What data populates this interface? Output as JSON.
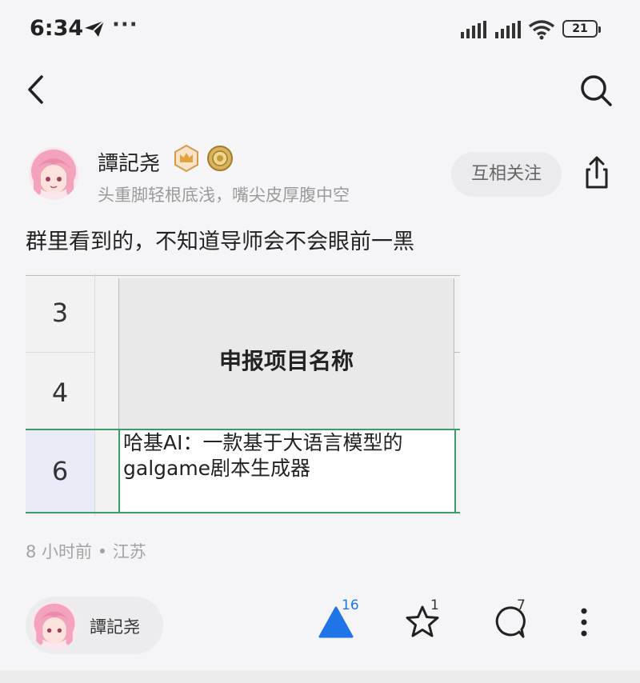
{
  "status_bar": {
    "time": "6:34",
    "more": "···",
    "battery": "21"
  },
  "author": {
    "name": "譚記尧",
    "bio": "头重脚轻根底浅，嘴尖皮厚腹中空",
    "follow_label": "互相关注"
  },
  "post": {
    "text": "群里看到的，不知道导师会不会眼前一黑",
    "meta": "8 小时前 • 江苏"
  },
  "sheet": {
    "row_numbers": [
      "3",
      "4",
      "6"
    ],
    "header": "申报项目名称",
    "cell_line1": "哈基AI：一款基于大语言模型的",
    "cell_line2": "galgame剧本生成器"
  },
  "bottom": {
    "author_name": "譚記尧",
    "like_count": "16",
    "favorite_count": "1",
    "comment_count": "7"
  },
  "colors": {
    "accent_blue": "#1f74e8",
    "sheet_green": "#3f9a6a",
    "background": "#f5f5f7"
  },
  "icons": [
    "telegram-send-icon",
    "signal-icon",
    "wifi-icon",
    "battery-icon",
    "back-icon",
    "search-icon",
    "crown-badge-icon",
    "coin-badge-icon",
    "share-icon",
    "like-triangle-icon",
    "star-icon",
    "comment-icon",
    "more-vertical-icon"
  ]
}
